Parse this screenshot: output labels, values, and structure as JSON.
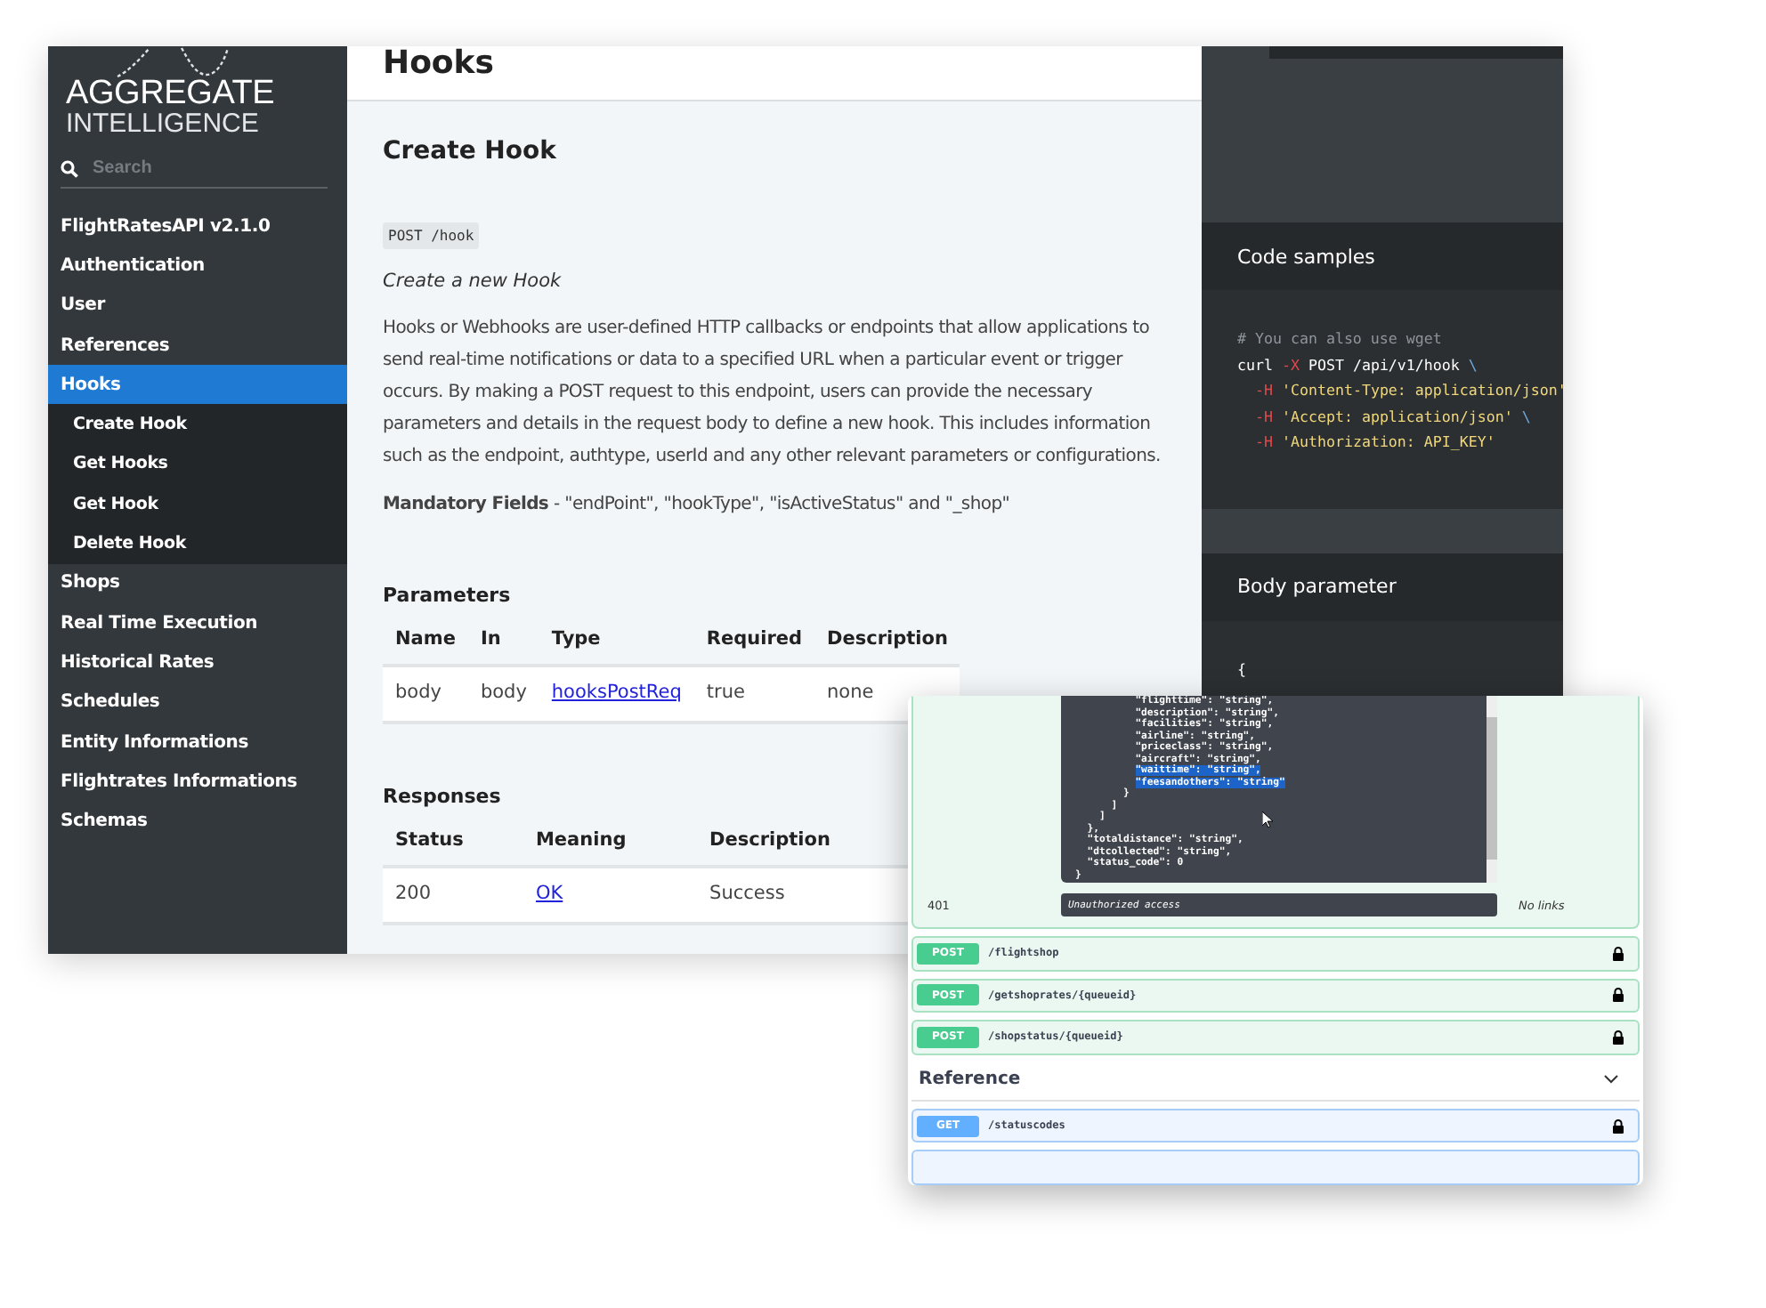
{
  "sidebar": {
    "logo": {
      "line1": "AGGREGATE",
      "line2": "INTELLIGENCE"
    },
    "search": {
      "placeholder": "Search"
    },
    "items": [
      {
        "label": "FlightRatesAPI v2.1.0",
        "selected": false
      },
      {
        "label": "Authentication",
        "selected": false
      },
      {
        "label": "User",
        "selected": false
      },
      {
        "label": "References",
        "selected": false
      },
      {
        "label": "Hooks",
        "selected": true,
        "expanded": true,
        "children": [
          {
            "label": "Create Hook",
            "selected": false
          },
          {
            "label": "Get Hooks",
            "selected": false
          },
          {
            "label": "Get Hook",
            "selected": false
          },
          {
            "label": "Delete Hook",
            "selected": false
          }
        ]
      },
      {
        "label": "Shops",
        "selected": false
      },
      {
        "label": "Real Time Execution",
        "selected": false
      },
      {
        "label": "Historical Rates",
        "selected": false
      },
      {
        "label": "Schedules",
        "selected": false
      },
      {
        "label": "Entity Informations",
        "selected": false
      },
      {
        "label": "Flightrates Informations",
        "selected": false
      },
      {
        "label": "Schemas",
        "selected": false
      }
    ]
  },
  "page_header": {
    "title": "Hooks"
  },
  "content": {
    "title": "Create Hook",
    "endpoint": "POST /hook",
    "summary": "Create a new Hook",
    "description": "Hooks or Webhooks are user-defined HTTP callbacks or endpoints that allow applications to send real-time notifications or data to a specified URL when a particular event or trigger occurs. By making a POST request to this endpoint, users can provide the necessary parameters and details in the request body to define a new hook. This includes information such as the endpoint, authtype, userId and any other relevant parameters or configurations.",
    "mandatory": "**Mandatory Fields** - \"endPoint\", \"hookType\", \"isActiveStatus\" and \"_shop\"",
    "tables": [
      {
        "title": "Parameters",
        "columns": [
          "Name",
          "In",
          "Type",
          "Required",
          "Description"
        ],
        "rows": [
          [
            {
              "kind": "text",
              "text": "body"
            },
            {
              "kind": "text",
              "text": "body"
            },
            {
              "kind": "link",
              "text": "hooksPostReq"
            },
            {
              "kind": "text",
              "text": "true"
            },
            {
              "kind": "text",
              "text": "none"
            }
          ]
        ]
      },
      {
        "title": "Responses",
        "columns": [
          "Status",
          "Meaning",
          "Description"
        ],
        "rows": [
          [
            {
              "kind": "text",
              "text": "200"
            },
            {
              "kind": "link",
              "text": "OK"
            },
            {
              "kind": "text",
              "text": "Success"
            }
          ]
        ]
      }
    ]
  },
  "code_panel": {
    "sections": [
      {
        "title": "Code samples",
        "lines": [
          [
            {
              "kind": "comment",
              "text": "# You can also use wget"
            }
          ],
          [
            {
              "kind": "plain",
              "text": "curl "
            },
            {
              "kind": "flag",
              "text": "-X"
            },
            {
              "kind": "plain",
              "text": " POST /api/v1/hook "
            },
            {
              "kind": "escape",
              "text": "\\"
            }
          ],
          [
            {
              "kind": "indent"
            },
            {
              "kind": "flag",
              "text": "-H"
            },
            {
              "kind": "string",
              "text": " 'Content-Type: application/json'"
            }
          ],
          [
            {
              "kind": "indent"
            },
            {
              "kind": "flag",
              "text": "-H"
            },
            {
              "kind": "string",
              "text": " 'Accept: application/json'"
            },
            {
              "kind": "escape",
              "text": " \\"
            }
          ],
          [
            {
              "kind": "indent"
            },
            {
              "kind": "flag",
              "text": "-H"
            },
            {
              "kind": "string",
              "text": " 'Authorization: API_KEY'"
            }
          ]
        ]
      },
      {
        "title": "Body parameter",
        "lines": [
          [
            {
              "kind": "plain",
              "text": "{"
            }
          ]
        ]
      }
    ]
  },
  "swagger": {
    "code_lines": [
      {
        "text": "          \"flighttime\": \"string\",",
        "selected": false
      },
      {
        "text": "          \"description\": \"string\",",
        "selected": false
      },
      {
        "text": "          \"facilities\": \"string\",",
        "selected": false
      },
      {
        "text": "          \"airline\": \"string\",",
        "selected": false
      },
      {
        "text": "          \"priceclass\": \"string\",",
        "selected": false
      },
      {
        "text": "          \"aircraft\": \"string\",",
        "selected": false
      },
      {
        "text": "          \"waittime\": \"string\",",
        "selected": true
      },
      {
        "text": "          \"feesandothers\": \"string\"",
        "selected": true
      },
      {
        "text": "        }",
        "selected": false
      },
      {
        "text": "      ]",
        "selected": false
      },
      {
        "text": "    ]",
        "selected": false
      },
      {
        "text": "  },",
        "selected": false
      },
      {
        "text": "  \"totaldistance\": \"string\",",
        "selected": false
      },
      {
        "text": "  \"dtcollected\": \"string\",",
        "selected": false
      },
      {
        "text": "  \"status_code\": 0",
        "selected": false
      },
      {
        "text": "}",
        "selected": false
      }
    ],
    "response": {
      "status": "401",
      "description": "Unauthorized access",
      "links": "No links"
    },
    "endpoints": [
      {
        "method": "POST",
        "path": "/flightshop"
      },
      {
        "method": "POST",
        "path": "/getshoprates/{queueid}"
      },
      {
        "method": "POST",
        "path": "/shopstatus/{queueid}"
      }
    ],
    "section": {
      "title": "Reference"
    },
    "ref_endpoints": [
      {
        "method": "GET",
        "path": "/statuscodes"
      }
    ]
  }
}
